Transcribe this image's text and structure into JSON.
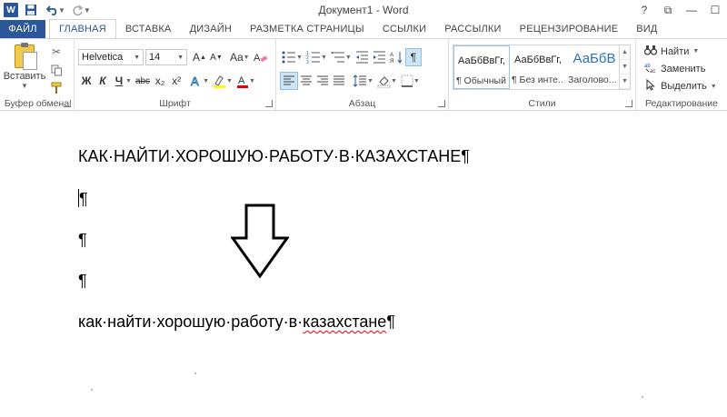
{
  "app": {
    "title": "Документ1 - Word",
    "logo": "W",
    "window_controls": {
      "help": "?",
      "restore": "⧉",
      "minimize": "—",
      "maximize": "☐"
    }
  },
  "quick_access": {
    "save_icon": "save-icon",
    "undo_icon": "undo-icon",
    "redo_icon": "redo-icon"
  },
  "tabs": [
    {
      "label": "ФАЙЛ"
    },
    {
      "label": "ГЛАВНАЯ"
    },
    {
      "label": "ВСТАВКА"
    },
    {
      "label": "ДИЗАЙН"
    },
    {
      "label": "РАЗМЕТКА СТРАНИЦЫ"
    },
    {
      "label": "ССЫЛКИ"
    },
    {
      "label": "РАССЫЛКИ"
    },
    {
      "label": "РЕЦЕНЗИРОВАНИЕ"
    },
    {
      "label": "ВИД"
    }
  ],
  "ribbon": {
    "clipboard": {
      "label": "Буфер обмена",
      "paste": "Вставить"
    },
    "font": {
      "label": "Шрифт",
      "font_name": "Helvetica",
      "font_size": "14",
      "grow": "A",
      "shrink": "A",
      "case": "Aa",
      "bold": "Ж",
      "italic": "К",
      "underline": "Ч",
      "strike": "abc",
      "subscript": "x₂",
      "superscript": "x²"
    },
    "paragraph": {
      "label": "Абзац",
      "pilcrow": "¶"
    },
    "styles": {
      "label": "Стили",
      "items": [
        {
          "sample": "АаБбВвГг,",
          "name": "¶ Обычный"
        },
        {
          "sample": "АаБбВвГг,",
          "name": "¶ Без инте..."
        },
        {
          "sample": "АаБбВ",
          "name": "Заголово..."
        }
      ]
    },
    "editing": {
      "label": "Редактирование",
      "find": "Найти",
      "replace": "Заменить",
      "select": "Выделить"
    }
  },
  "document": {
    "line1": "КАК·НАЙТИ·ХОРОШУЮ·РАБОТУ·В·КАЗАХСТАНЕ¶",
    "pilcrow": "¶",
    "line5_pre": "как·найти·хорошую·работу·в·",
    "line5_word": "казахстане",
    "line5_end": "¶"
  }
}
